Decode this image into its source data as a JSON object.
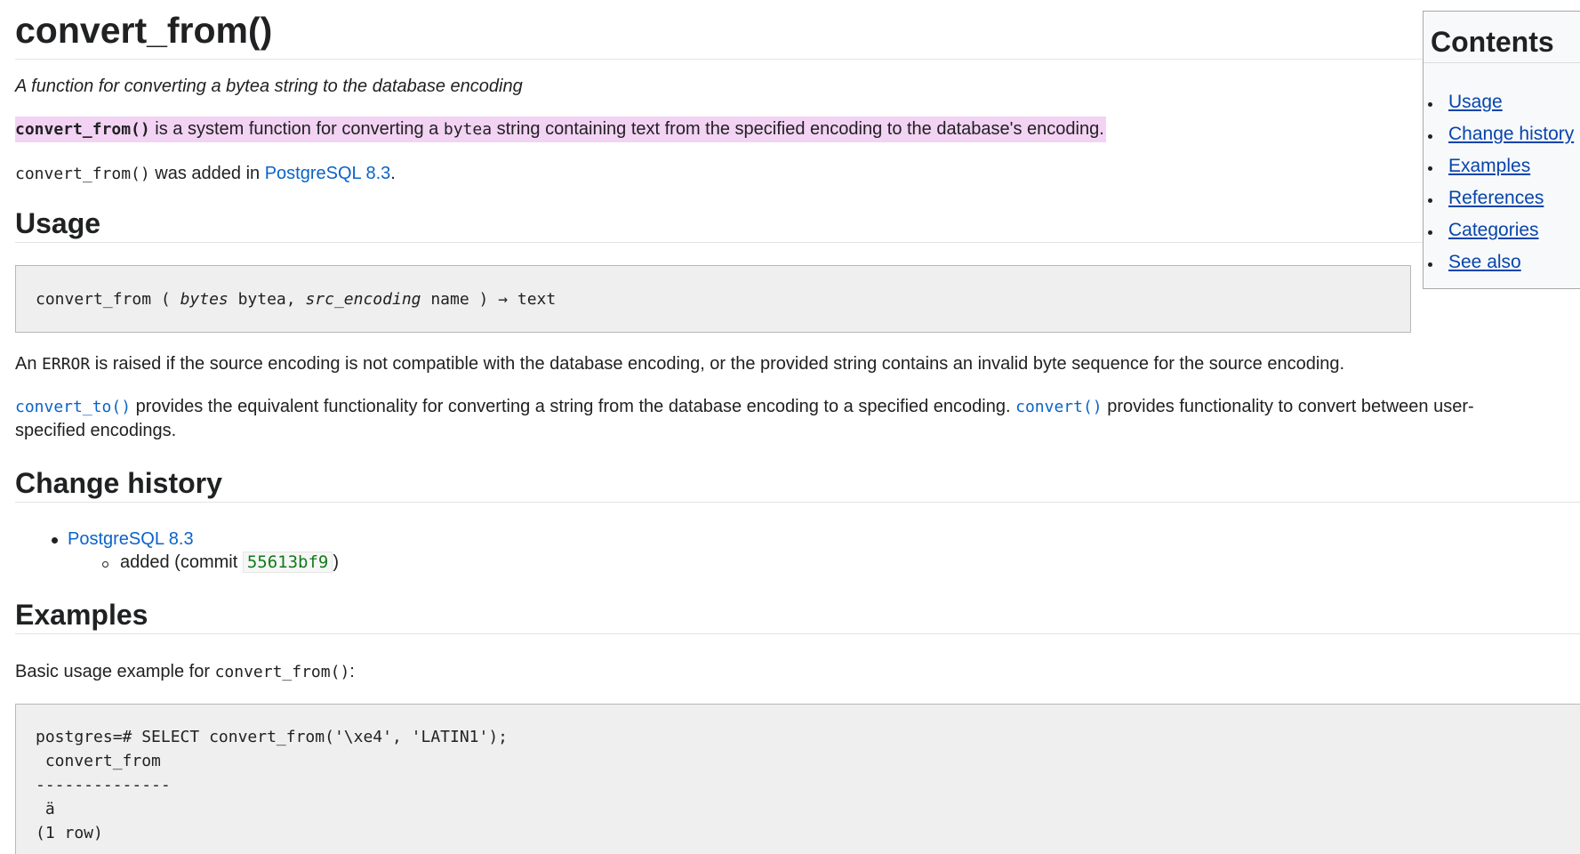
{
  "page": {
    "title": "convert_from()",
    "subtitle": "A function for converting a bytea string to the database encoding",
    "lead": {
      "func": "convert_from()",
      "text1": " is a system function for converting a ",
      "type": "bytea",
      "text2": " string containing text from the specified encoding to the database's encoding."
    },
    "added": {
      "func": "convert_from()",
      "text": " was added in ",
      "link": "PostgreSQL 8.3",
      "end": "."
    }
  },
  "usage": {
    "heading": "Usage",
    "signature": {
      "name": "convert_from ( ",
      "arg1": "bytes",
      "type1": " bytea, ",
      "arg2": "src_encoding",
      "type2": " name ) → text"
    },
    "error_para": {
      "t1": "An ",
      "code": "ERROR",
      "t2": " is raised if the source encoding is not compatible with the database encoding, or the provided string contains an invalid byte sequence for the source encoding."
    },
    "related_para": {
      "link1": "convert_to()",
      "t1": " provides the equivalent functionality for converting a string from the database encoding to a specified encoding. ",
      "link2": "convert()",
      "t2": " provides functionality to convert between user-",
      "t3": "specified encodings."
    }
  },
  "history": {
    "heading": "Change history",
    "items": [
      {
        "version": "PostgreSQL 8.3",
        "note_prefix": "added (commit ",
        "commit": "55613bf9",
        "note_suffix": ")"
      }
    ]
  },
  "examples": {
    "heading": "Examples",
    "intro_text": "Basic usage example for ",
    "intro_func": "convert_from()",
    "intro_end": ":",
    "code_lines": [
      "postgres=# SELECT convert_from('\\xe4', 'LATIN1');",
      " convert_from",
      "--------------",
      " ä",
      "(1 row)"
    ]
  },
  "toc": {
    "title": "Contents",
    "items": [
      "Usage",
      "Change history",
      "Examples",
      "References",
      "Categories",
      "See also"
    ]
  }
}
